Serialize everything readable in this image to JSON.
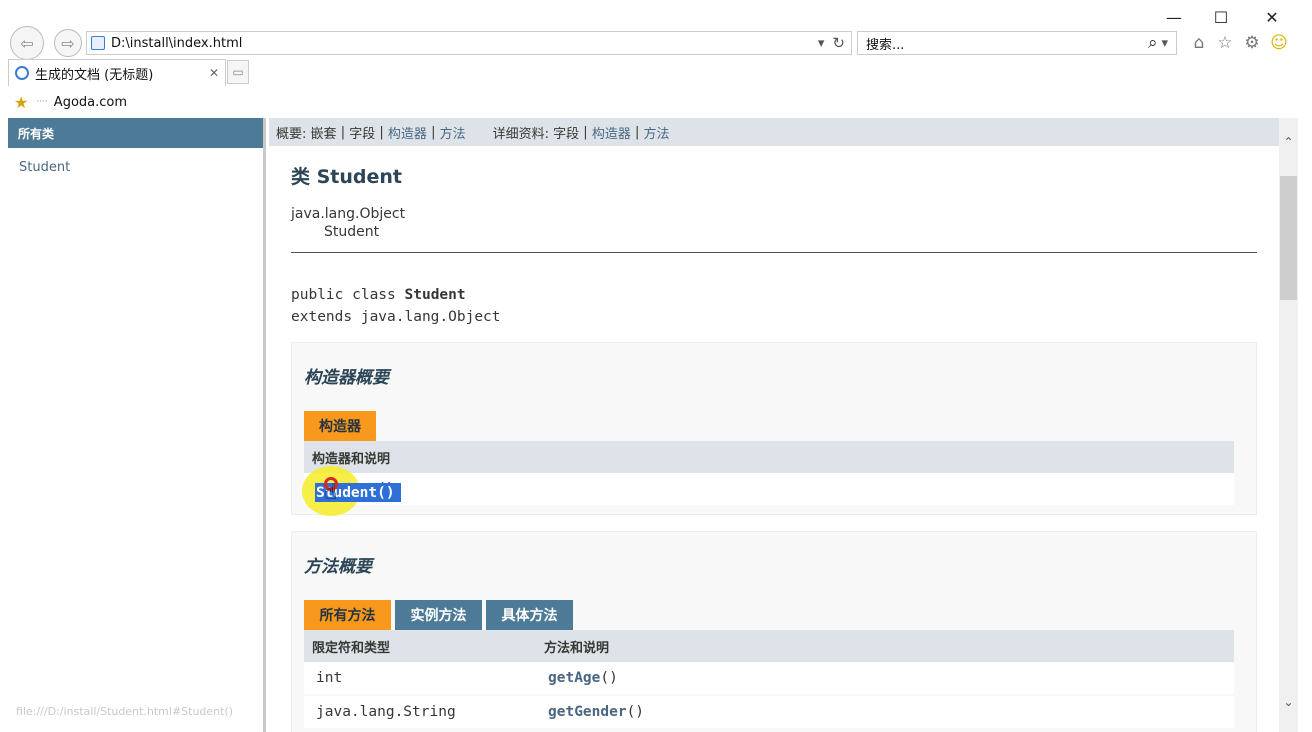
{
  "window": {
    "minimize": "—",
    "maximize": "☐",
    "close": "✕"
  },
  "address_bar": {
    "url": "D:\\install\\index.html",
    "dropdown": "▾",
    "refresh": "↻"
  },
  "search": {
    "placeholder": "搜索...",
    "icon": "⌕",
    "dropdown": "▾"
  },
  "tab": {
    "title": "生成的文档 (无标题)",
    "close": "✕"
  },
  "favorites": {
    "item": "Agoda.com"
  },
  "left_frame": {
    "header": "所有类",
    "classes": [
      "Student"
    ]
  },
  "subnav": {
    "summary_label": "概要:",
    "nested": "嵌套",
    "field": "字段",
    "constructor": "构造器",
    "method": "方法",
    "detail_label": "详细资料:",
    "detail_field": "字段",
    "detail_constructor": "构造器",
    "detail_method": "方法",
    "sep": "|"
  },
  "class_doc": {
    "title": "类 Student",
    "inheritance_root": "java.lang.Object",
    "inheritance_child": "Student",
    "decl_prefix": "public class ",
    "decl_name": "Student",
    "decl_extends": "extends java.lang.Object"
  },
  "constructor_summary": {
    "title": "构造器概要",
    "tab": "构造器",
    "header": "构造器和说明",
    "rows": [
      "Student()"
    ]
  },
  "method_summary": {
    "title": "方法概要",
    "tabs": [
      "所有方法",
      "实例方法",
      "具体方法"
    ],
    "headers": [
      "限定符和类型",
      "方法和说明"
    ],
    "rows": [
      {
        "type": "int",
        "name": "getAge",
        "params": "()"
      },
      {
        "type": "java.lang.String",
        "name": "getGender",
        "params": "()"
      }
    ]
  },
  "status_bar": {
    "url": "file:///D:/install/Student.html#Student()"
  }
}
